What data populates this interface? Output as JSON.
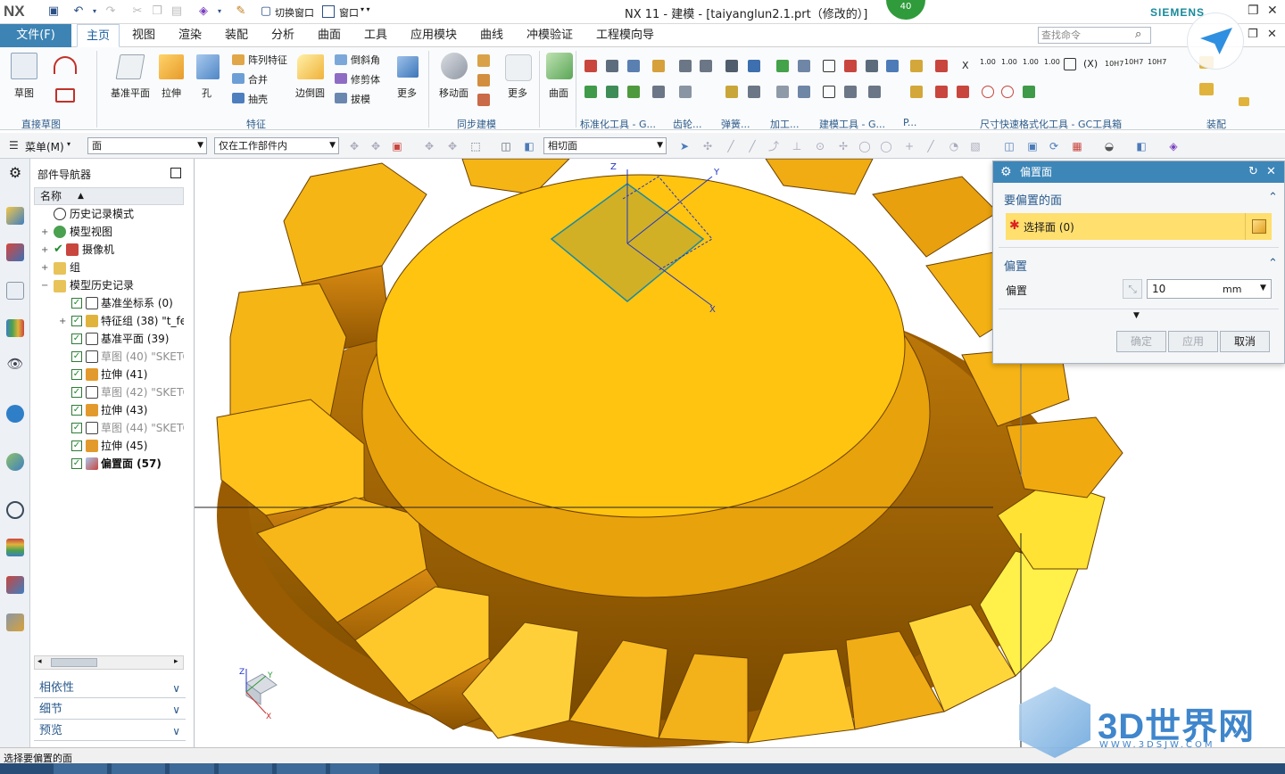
{
  "title_bar": {
    "logo": "NX",
    "switch_window": "切换窗口",
    "window_menu": "窗口",
    "window_title": "NX 11 - 建模 - [taiyanglun2.1.prt（修改的）]",
    "badge": "40",
    "brand": "SIEMENS"
  },
  "tabs": {
    "file": "文件(F)",
    "items": [
      "主页",
      "视图",
      "渲染",
      "装配",
      "分析",
      "曲面",
      "工具",
      "应用模块",
      "曲线",
      "冲模验证",
      "工程模向导"
    ],
    "active": "主页",
    "search_placeholder": "查找命令"
  },
  "ribbon": {
    "sketch": "草图",
    "datum_plane": "基准平面",
    "extrude": "拉伸",
    "hole": "孔",
    "pattern_feature": "阵列特征",
    "unite": "合并",
    "shell": "抽壳",
    "edge_blend": "边倒圆",
    "chamfer": "倒斜角",
    "trim_body": "修剪体",
    "draft": "拔模",
    "more1": "更多",
    "move_face": "移动面",
    "more2": "更多",
    "surface": "曲面",
    "groups": {
      "direct_sketch": "直接草图",
      "feature": "特征",
      "sync_modeling": "同步建模",
      "standard_tools": "标准化工具 - G...",
      "gear": "齿轮...",
      "spring": "弹簧...",
      "machining": "加工...",
      "modeling_tools": "建模工具 - G...",
      "p": "P...",
      "dimension_tools": "尺寸快速格式化工具 - GC工具箱",
      "assembly": "装配"
    },
    "dim_tags": [
      "1.00",
      "1.00",
      "1.00",
      "1.00",
      "10H7",
      "10H7",
      "10H7"
    ],
    "dim_x": "X",
    "assembly_label": "装配"
  },
  "toolbar2": {
    "menu": "菜单(M)",
    "filter": "面",
    "scope": "仅在工作部件内",
    "face_rule": "相切面"
  },
  "navigator": {
    "title": "部件导航器",
    "column": "名称",
    "nodes": [
      {
        "label": "历史记录模式",
        "state": "root"
      },
      {
        "label": "模型视图",
        "state": "root"
      },
      {
        "label": "摄像机",
        "state": "root"
      },
      {
        "label": "组",
        "state": "root"
      },
      {
        "label": "模型历史记录",
        "state": "root"
      },
      {
        "label": "基准坐标系 (0)",
        "state": "on"
      },
      {
        "label": "特征组 (38) \"t_fea",
        "state": "on"
      },
      {
        "label": "基准平面 (39)",
        "state": "on"
      },
      {
        "label": "草图 (40) \"SKETC",
        "state": "gray"
      },
      {
        "label": "拉伸 (41)",
        "state": "on"
      },
      {
        "label": "草图 (42) \"SKETC",
        "state": "gray"
      },
      {
        "label": "拉伸 (43)",
        "state": "on"
      },
      {
        "label": "草图 (44) \"SKETC",
        "state": "gray"
      },
      {
        "label": "拉伸 (45)",
        "state": "on"
      },
      {
        "label": "偏置面 (57)",
        "state": "bold"
      }
    ],
    "panels": [
      "相依性",
      "细节",
      "预览"
    ]
  },
  "dialog": {
    "title": "偏置面",
    "section1": "要偏置的面",
    "select_face": "选择面 (0)",
    "section2": "偏置",
    "offset_label": "偏置",
    "offset_value": "10",
    "unit": "mm",
    "ok": "确定",
    "apply": "应用",
    "cancel": "取消"
  },
  "status": "选择要偏置的面",
  "watermark": {
    "text": "3D世界网",
    "url": "WWW.3DSJW.COM"
  },
  "triad": {
    "x": "X",
    "y": "Y",
    "z": "Z"
  },
  "datum_csys_labels": {
    "x": "X",
    "y": "Y",
    "z": "Z"
  }
}
